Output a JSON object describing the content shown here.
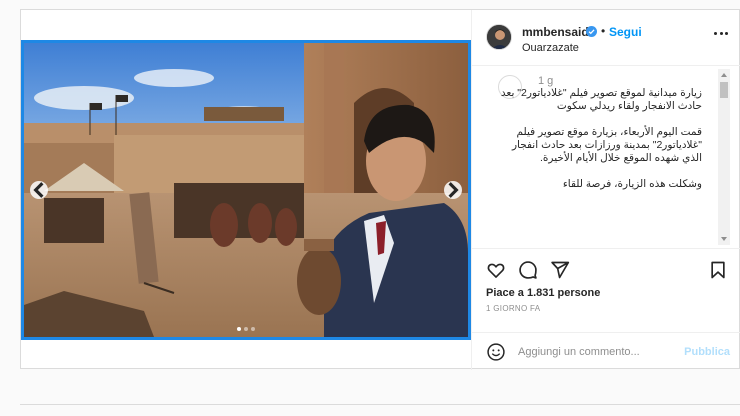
{
  "header": {
    "username": "mmbensaid",
    "separator": "•",
    "follow_label": "Segui",
    "location": "Ouarzazate",
    "avatar_icon": "user-avatar",
    "more_icon": "more-options-icon"
  },
  "media": {
    "description_icon": "movie-set-photo",
    "carousel": {
      "slides": 3,
      "active": 1
    }
  },
  "comment": {
    "time": "1 g",
    "text": "زيارة ميدانية لموقع تصوير فيلم \"غلادياتور2\" بعد حادث الانفجار ولقاء ريدلي سكوت\n\nقمت اليوم الأربعاء، بزيارة موقع تصوير فيلم \"غلادياتور2\" بمدينة ورزازات بعد حادث انفجار الذي شهده الموقع خلال الأيام الأخيرة.\n\nوشكلت هذه الزيارة، فرصة للقاء"
  },
  "actions": {
    "like_icon": "heart-icon",
    "comment_icon": "comment-icon",
    "share_icon": "share-icon",
    "save_icon": "bookmark-icon"
  },
  "likes_text": "Piace a 1.831 persone",
  "time_ago": "1 GIORNO FA",
  "comment_box": {
    "placeholder": "Aggiungi un commento...",
    "publish_label": "Pubblica"
  },
  "colors": {
    "accent": "#0095f6",
    "verified": "#3897f0",
    "media_border": "#1e88e5",
    "publish_disabled": "#b2dffc"
  }
}
